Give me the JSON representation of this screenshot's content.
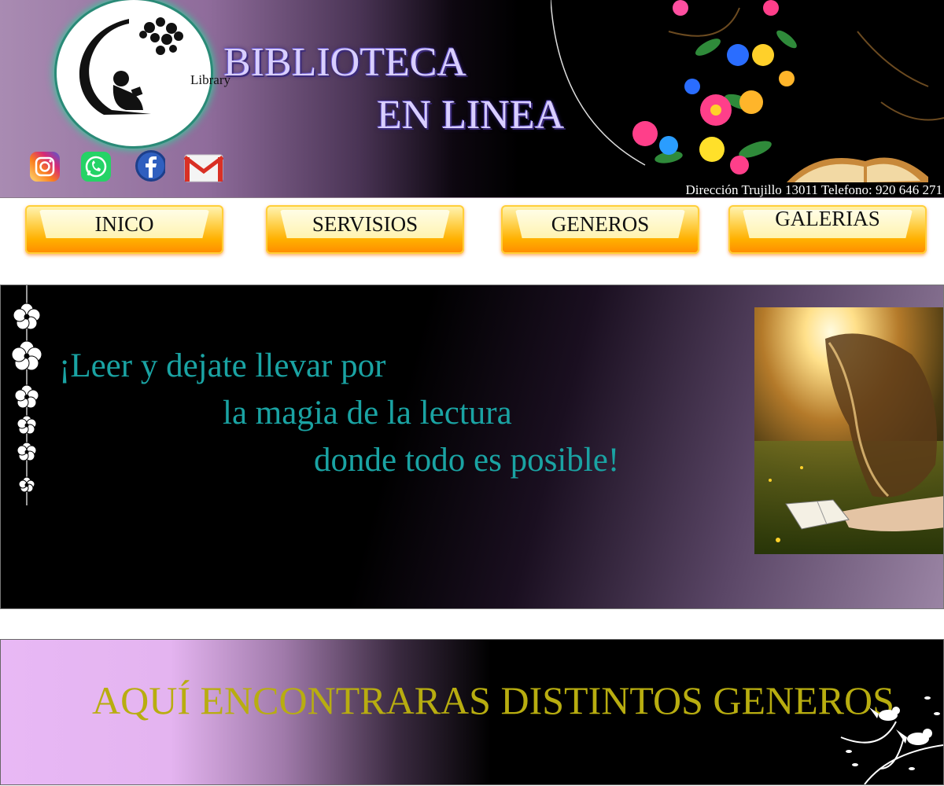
{
  "header": {
    "logo_text": "Library",
    "title_line1": "BIBLIOTECA",
    "title_line2": "EN LINEA",
    "address": "Dirección Trujillo 13011   Telefono: 920 646 271",
    "social": [
      {
        "name": "instagram-icon",
        "color": "#d6249f"
      },
      {
        "name": "whatsapp-icon",
        "color": "#25d366"
      },
      {
        "name": "facebook-icon",
        "color": "#1877f2"
      },
      {
        "name": "gmail-icon",
        "color": "#d93025"
      }
    ]
  },
  "nav": {
    "items": [
      {
        "label": "INICO"
      },
      {
        "label": "SERVISIOS"
      },
      {
        "label": "GENEROS"
      },
      {
        "label": "GALERIAS"
      }
    ]
  },
  "banner": {
    "line1": "¡Leer y dejate llevar por",
    "line2": "la magia de la lectura",
    "line3": "donde todo es posible!"
  },
  "generos": {
    "heading": "AQUÍ ENCONTRARAS DISTINTOS GENEROS"
  },
  "colors": {
    "title_color": "#d9cfff",
    "quote_color": "#1aa3a3",
    "generos_color": "#b8ad10",
    "nav_button": "#ffb000"
  }
}
